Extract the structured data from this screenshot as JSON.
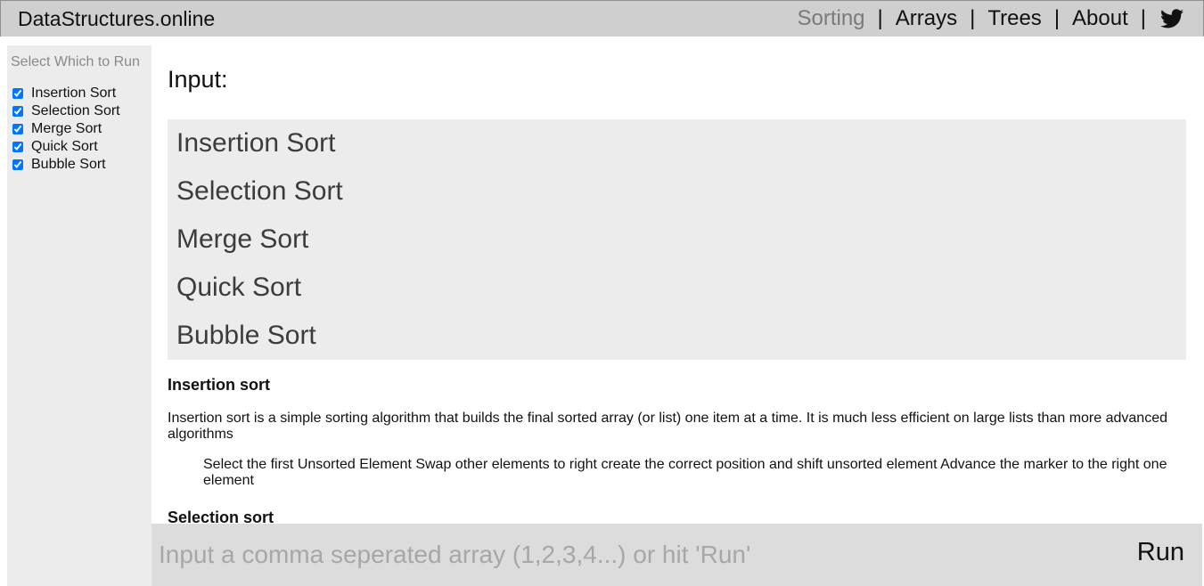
{
  "header": {
    "brand": "DataStructures.online",
    "nav": [
      {
        "label": "Sorting",
        "active": true
      },
      {
        "label": "Arrays",
        "active": false
      },
      {
        "label": "Trees",
        "active": false
      },
      {
        "label": "About",
        "active": false
      }
    ],
    "separator": "|",
    "social_icon": "twitter-bird-icon"
  },
  "sidebar": {
    "title": "Select Which to Run",
    "options": [
      {
        "label": "Insertion Sort",
        "checked": true
      },
      {
        "label": "Selection Sort",
        "checked": true
      },
      {
        "label": "Merge Sort",
        "checked": true
      },
      {
        "label": "Quick Sort",
        "checked": true
      },
      {
        "label": "Bubble Sort",
        "checked": true
      }
    ]
  },
  "main": {
    "input_heading": "Input:",
    "algorithms": [
      "Insertion Sort",
      "Selection Sort",
      "Merge Sort",
      "Quick Sort",
      "Bubble Sort"
    ],
    "descriptions": [
      {
        "title": "Insertion sort",
        "text": "Insertion sort is a simple sorting algorithm that builds the final sorted array (or list) one item at a time. It is much less efficient on large lists than more advanced algorithms",
        "steps": "Select the first Unsorted Element Swap other elements to right create the correct position and shift unsorted element Advance the marker to the right one element"
      },
      {
        "title": "Selection sort"
      }
    ]
  },
  "footer": {
    "input_placeholder": "Input a comma seperated array (1,2,3,4...) or hit 'Run'",
    "input_value": "",
    "run_label": "Run"
  },
  "colors": {
    "header_bg": "#cfcfcf",
    "sidebar_bg": "#ececec",
    "algo_box_bg": "#ececec",
    "footer_bg": "#dcdcdc",
    "active_nav": "#7a7a7a"
  }
}
